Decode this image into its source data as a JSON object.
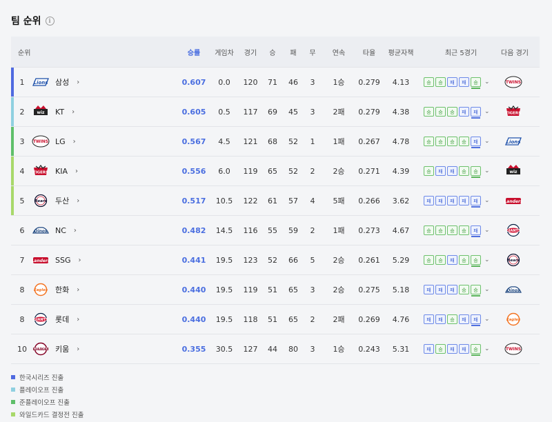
{
  "title": "팀 순위",
  "headers": {
    "rank": "순위",
    "pct": "승률",
    "gb": "게임차",
    "games": "경기",
    "wins": "승",
    "losses": "패",
    "draws": "무",
    "streak": "연속",
    "avg": "타율",
    "era": "평균자책",
    "last5": "최근 5경기",
    "next": "다음 경기"
  },
  "colors": {
    "korean_series": "#4f6ae0",
    "playoff": "#8fd0e0",
    "semi_playoff": "#5fbf6a",
    "wildcard": "#a8d86a"
  },
  "rows": [
    {
      "rank": "1",
      "team": "삼성",
      "logo": "lions-logo",
      "pct": "0.607",
      "gb": "0.0",
      "games": "120",
      "wins": "71",
      "losses": "46",
      "draws": "3",
      "streak": "1승",
      "avg": "0.279",
      "era": "4.13",
      "last5": [
        "승",
        "승",
        "패",
        "패",
        "승"
      ],
      "next_logo": "twins-logo",
      "bar": "korean_series"
    },
    {
      "rank": "2",
      "team": "KT",
      "logo": "wiz-logo",
      "pct": "0.605",
      "gb": "0.5",
      "games": "117",
      "wins": "69",
      "losses": "45",
      "draws": "3",
      "streak": "2패",
      "avg": "0.279",
      "era": "4.38",
      "last5": [
        "승",
        "승",
        "승",
        "패",
        "패"
      ],
      "next_logo": "tigers-logo",
      "bar": "playoff"
    },
    {
      "rank": "3",
      "team": "LG",
      "logo": "twins-logo",
      "pct": "0.567",
      "gb": "4.5",
      "games": "121",
      "wins": "68",
      "losses": "52",
      "draws": "1",
      "streak": "1패",
      "avg": "0.267",
      "era": "4.78",
      "last5": [
        "승",
        "승",
        "승",
        "승",
        "패"
      ],
      "next_logo": "lions-logo",
      "bar": "semi_playoff"
    },
    {
      "rank": "4",
      "team": "KIA",
      "logo": "tigers-logo",
      "pct": "0.556",
      "gb": "6.0",
      "games": "119",
      "wins": "65",
      "losses": "52",
      "draws": "2",
      "streak": "2승",
      "avg": "0.271",
      "era": "4.39",
      "last5": [
        "승",
        "패",
        "패",
        "승",
        "승"
      ],
      "next_logo": "wiz-logo",
      "bar": "wildcard"
    },
    {
      "rank": "5",
      "team": "두산",
      "logo": "bears-logo",
      "pct": "0.517",
      "gb": "10.5",
      "games": "122",
      "wins": "61",
      "losses": "57",
      "draws": "4",
      "streak": "5패",
      "avg": "0.266",
      "era": "3.62",
      "last5": [
        "패",
        "패",
        "패",
        "패",
        "패"
      ],
      "next_logo": "landers-logo",
      "bar": "wildcard"
    },
    {
      "rank": "6",
      "team": "NC",
      "logo": "dinos-logo",
      "pct": "0.482",
      "gb": "14.5",
      "games": "116",
      "wins": "55",
      "losses": "59",
      "draws": "2",
      "streak": "1패",
      "avg": "0.273",
      "era": "4.67",
      "last5": [
        "승",
        "승",
        "승",
        "승",
        "패"
      ],
      "next_logo": "giants-logo",
      "bar": "none"
    },
    {
      "rank": "7",
      "team": "SSG",
      "logo": "landers-logo",
      "pct": "0.441",
      "gb": "19.5",
      "games": "123",
      "wins": "52",
      "losses": "66",
      "draws": "5",
      "streak": "2승",
      "avg": "0.261",
      "era": "5.29",
      "last5": [
        "승",
        "승",
        "패",
        "승",
        "승"
      ],
      "next_logo": "bears-logo",
      "bar": "none"
    },
    {
      "rank": "8",
      "team": "한화",
      "logo": "eagles-logo",
      "pct": "0.440",
      "gb": "19.5",
      "games": "119",
      "wins": "51",
      "losses": "65",
      "draws": "3",
      "streak": "2승",
      "avg": "0.275",
      "era": "5.18",
      "last5": [
        "패",
        "패",
        "패",
        "승",
        "승"
      ],
      "next_logo": "dinos-logo",
      "bar": "none"
    },
    {
      "rank": "8",
      "team": "롯데",
      "logo": "giants-logo",
      "pct": "0.440",
      "gb": "19.5",
      "games": "118",
      "wins": "51",
      "losses": "65",
      "draws": "2",
      "streak": "2패",
      "avg": "0.269",
      "era": "4.76",
      "last5": [
        "패",
        "패",
        "승",
        "패",
        "패"
      ],
      "next_logo": "eagles-logo",
      "bar": "none"
    },
    {
      "rank": "10",
      "team": "키움",
      "logo": "heroes-logo",
      "pct": "0.355",
      "gb": "30.5",
      "games": "127",
      "wins": "44",
      "losses": "80",
      "draws": "3",
      "streak": "1승",
      "avg": "0.243",
      "era": "5.31",
      "last5": [
        "패",
        "승",
        "패",
        "패",
        "승"
      ],
      "next_logo": "twins-logo",
      "bar": "none"
    }
  ],
  "legend": [
    {
      "label": "한국시리즈 진출",
      "color": "korean_series"
    },
    {
      "label": "플레이오프 진출",
      "color": "playoff"
    },
    {
      "label": "준플레이오프 진출",
      "color": "semi_playoff"
    },
    {
      "label": "와일드카드 결정전 진출",
      "color": "wildcard"
    }
  ]
}
